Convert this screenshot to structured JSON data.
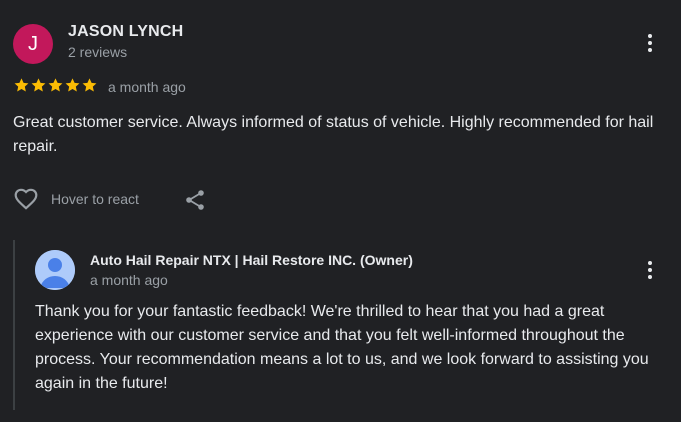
{
  "review": {
    "avatar_letter": "J",
    "avatar_color": "#c2185b",
    "reviewer_name": "JASON LYNCH",
    "review_count": "2 reviews",
    "rating": 5,
    "star_color": "#fbbc04",
    "timestamp": "a month ago",
    "text": "Great customer service. Always informed of status of vehicle. Highly recommended for hail repair.",
    "more_icon": "more-vert-icon"
  },
  "actions": {
    "react_icon": "heart-outline-icon",
    "react_label": "Hover to react",
    "share_icon": "share-icon"
  },
  "owner_reply": {
    "avatar_icon": "default-profile-icon",
    "name": "Auto Hail Repair NTX | Hail Restore INC. (Owner)",
    "timestamp": "a month ago",
    "text": "Thank you for your fantastic feedback! We're thrilled to hear that you had a great experience with our customer service and that you felt well-informed throughout the process. Your recommendation means a lot to us, and we look forward to assisting you again in the future!",
    "more_icon": "more-vert-icon"
  }
}
